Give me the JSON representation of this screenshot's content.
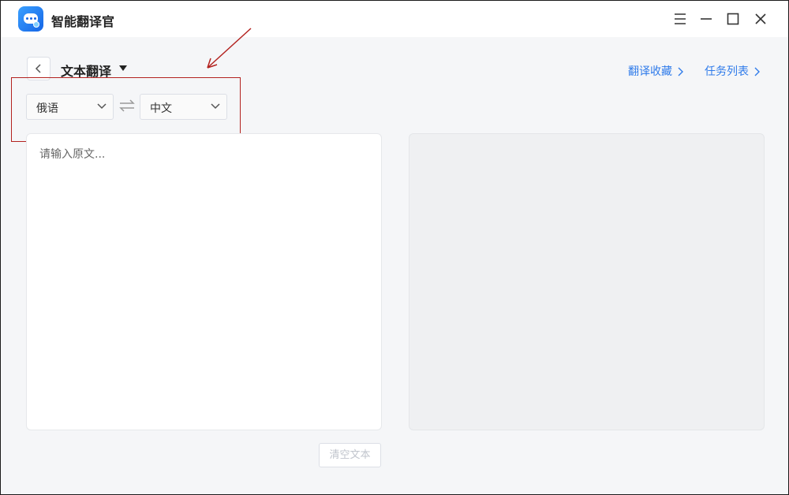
{
  "app": {
    "title": "智能翻译官",
    "logo_icon": "chat-bubble-icon"
  },
  "window_controls": [
    "menu-icon",
    "minimize-icon",
    "maximize-icon",
    "close-icon"
  ],
  "header": {
    "mode_title": "文本翻译",
    "links": {
      "favorites": "翻译收藏",
      "tasks": "任务列表"
    }
  },
  "languages": {
    "source": "俄语",
    "target": "中文"
  },
  "input": {
    "placeholder": "请输入原文...",
    "value": ""
  },
  "actions": {
    "clear_label": "清空文本"
  },
  "colors": {
    "accent": "#2f7bea",
    "annotation": "#b3221f"
  }
}
